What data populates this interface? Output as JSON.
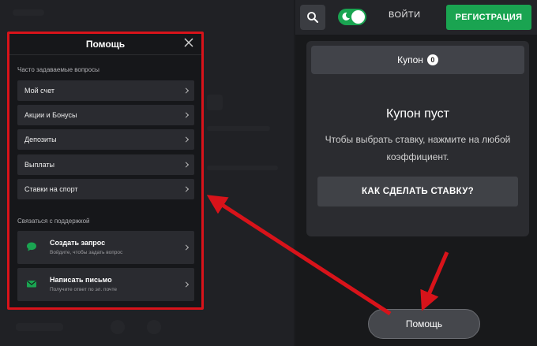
{
  "topbar": {
    "search_icon": "search-icon",
    "theme_toggle_icon": "moon-icon",
    "login_label": "ВОЙТИ",
    "register_label": "РЕГИСТРАЦИЯ"
  },
  "coupon": {
    "tab_label": "Купон",
    "count": "0",
    "empty_title": "Купон пуст",
    "empty_desc": "Чтобы выбрать ставку, нажмите на любой коэффициент.",
    "how_to_bet_label": "КАК СДЕЛАТЬ СТАВКУ?"
  },
  "help_button_label": "Помощь",
  "help_modal": {
    "title": "Помощь",
    "close_icon": "close-icon",
    "faq_label": "Часто задаваемые вопросы",
    "faq_items": [
      {
        "label": "Мой счет"
      },
      {
        "label": "Акции и Бонусы"
      },
      {
        "label": "Депозиты"
      },
      {
        "label": "Выплаты"
      },
      {
        "label": "Ставки на спорт"
      }
    ],
    "support_label": "Связаться с поддержкой",
    "support_items": [
      {
        "title": "Создать запрос",
        "subtitle": "Войдите, чтобы задать вопрос",
        "icon": "chat-icon"
      },
      {
        "title": "Написать письмо",
        "subtitle": "Получите ответ по эл. почте",
        "icon": "mail-icon"
      }
    ]
  },
  "colors": {
    "accent_green": "#1aa451",
    "highlight_red": "#d8131a"
  }
}
